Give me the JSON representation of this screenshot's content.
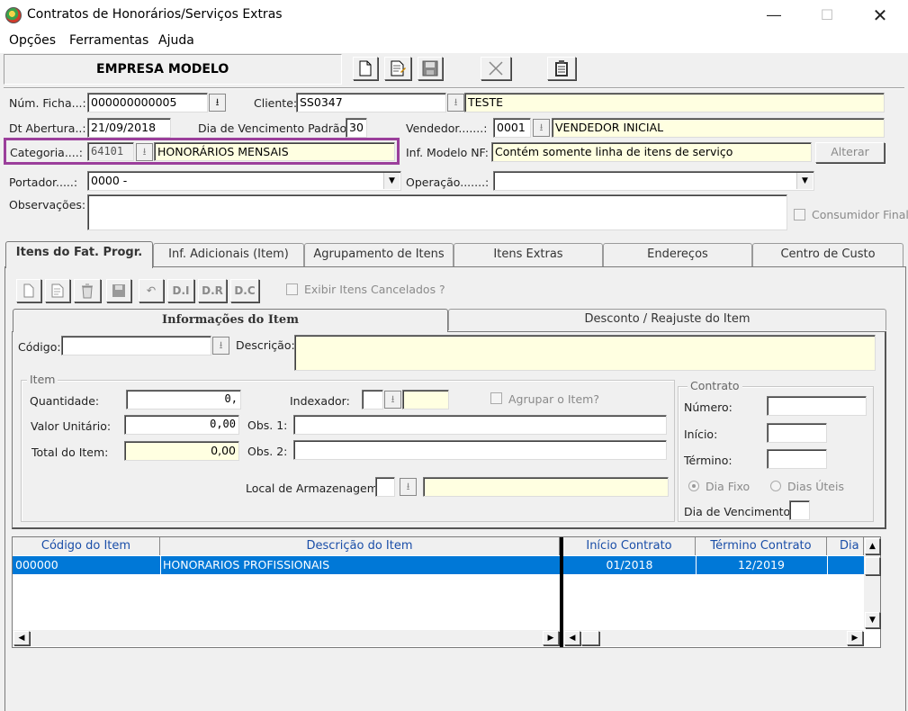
{
  "window": {
    "title": "Contratos de Honorários/Serviços Extras"
  },
  "menu": [
    "Opções",
    "Ferramentas",
    "Ajuda"
  ],
  "toolbar": {
    "company": "EMPRESA MODELO"
  },
  "header": {
    "num_ficha_label": "Núm. Ficha...:",
    "num_ficha_value": "000000000005",
    "cliente_label": "Cliente:",
    "cliente_code": "SS0347",
    "cliente_name": "TESTE",
    "dt_abertura_label": "Dt Abertura..:",
    "dt_abertura_value": "21/09/2018",
    "dia_venc_label": "Dia de Vencimento Padrão:",
    "dia_venc_value": "30",
    "vendedor_label": "Vendedor.......:",
    "vendedor_code": "0001",
    "vendedor_name": "VENDEDOR INICIAL",
    "categoria_label": "Categoria....:",
    "categoria_code": "64101",
    "categoria_name": "HONORÁRIOS MENSAIS",
    "inf_modelo_label": "Inf. Modelo NF:",
    "inf_modelo_value": "Contém somente linha de itens de serviço",
    "alterar_label": "Alterar",
    "portador_label": "Portador.....:",
    "portador_value": "0000 -",
    "operacao_label": "Operação.......:",
    "operacao_value": "",
    "observacoes_label": "Observações:",
    "consumidor_final_label": "Consumidor Final"
  },
  "tabs": [
    "Itens do Fat. Progr.",
    "Inf. Adicionais (Item)",
    "Agrupamento de Itens",
    "Itens Extras",
    "Endereços",
    "Centro de Custo"
  ],
  "item_toolbar": {
    "di": "D.I",
    "dr": "D.R",
    "dc": "D.C",
    "exibir_cancelados": "Exibir Itens Cancelados ?"
  },
  "subtabs": [
    "Informações do Item",
    "Desconto / Reajuste do Item"
  ],
  "item": {
    "codigo_label": "Código:",
    "codigo_value": "",
    "descricao_label": "Descrição:",
    "descricao_value": "",
    "group_item": "Item",
    "quantidade_label": "Quantidade:",
    "quantidade_value": "0,",
    "indexador_label": "Indexador:",
    "agrupar_label": "Agrupar o Item?",
    "valor_unitario_label": "Valor Unitário:",
    "valor_unitario_value": "0,00",
    "obs1_label": "Obs. 1:",
    "total_label": "Total do Item:",
    "total_value": "0,00",
    "obs2_label": "Obs. 2:",
    "local_label": "Local de Armazenagem:",
    "group_contrato": "Contrato",
    "numero_label": "Número:",
    "inicio_label": "Início:",
    "termino_label": "Término:",
    "dia_fixo_label": "Dia Fixo",
    "dias_uteis_label": "Dias Úteis",
    "dia_venc_label": "Dia de Vencimento:"
  },
  "grid": {
    "columns": [
      "Código do Item",
      "Descrição do Item",
      "Início Contrato",
      "Término Contrato",
      "Dia V"
    ],
    "rows": [
      {
        "codigo": "000000",
        "descricao": "HONORARIOS PROFISSIONAIS",
        "inicio": "01/2018",
        "termino": "12/2019"
      }
    ]
  },
  "colors": {
    "highlight": "#9b3f9b",
    "selection": "#0078d7",
    "field_yellow": "#ffffe1"
  }
}
